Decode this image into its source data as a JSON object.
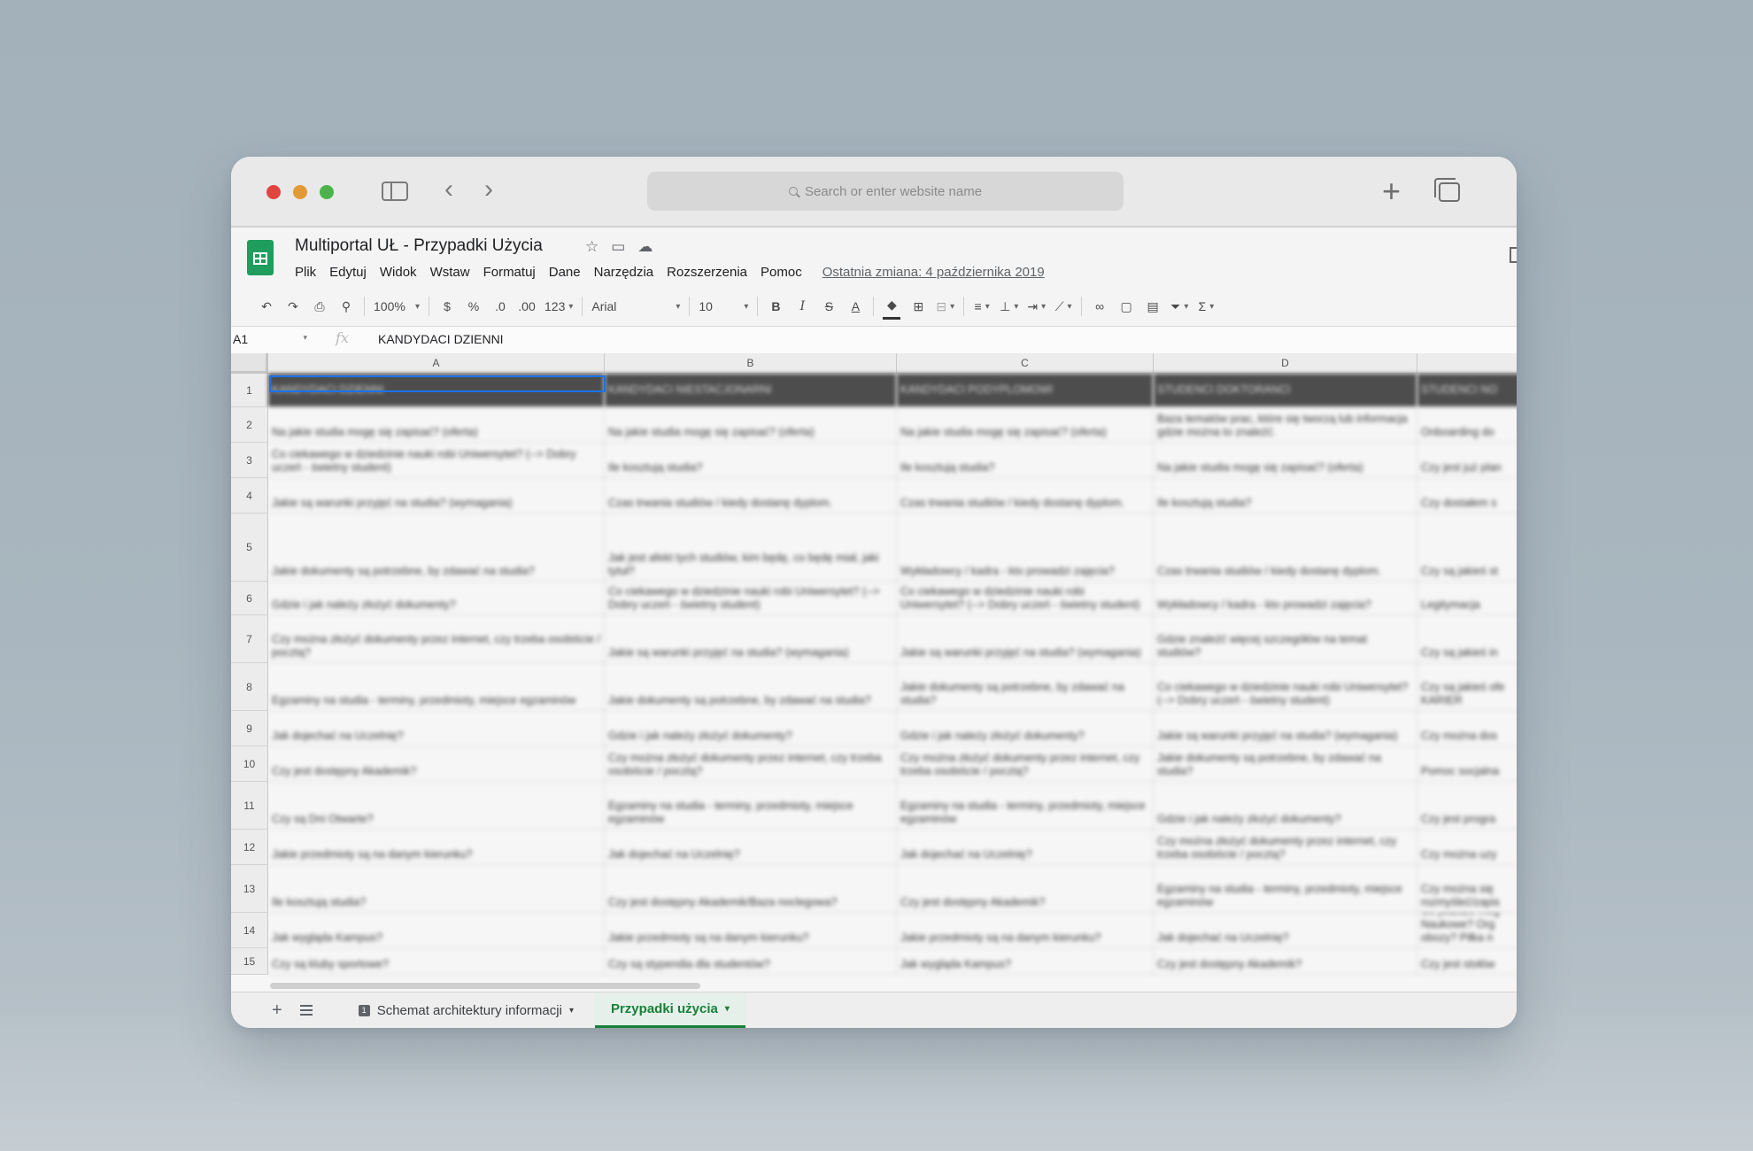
{
  "browser": {
    "search_placeholder": "Search or enter website name",
    "back_glyph": "‹",
    "forward_glyph": "›",
    "new_tab_glyph": "+"
  },
  "doc": {
    "title": "Multiportal UŁ - Przypadki Użycia",
    "last_edit": "Ostatnia zmiana: 4 października 2019"
  },
  "menu": [
    "Plik",
    "Edytuj",
    "Widok",
    "Wstaw",
    "Formatuj",
    "Dane",
    "Narzędzia",
    "Rozszerzenia",
    "Pomoc"
  ],
  "toolbar": {
    "zoom": "100%",
    "currency": "$",
    "percent": "%",
    "dec_decrease": ".0",
    "dec_increase": ".00",
    "more_formats": "123",
    "font": "Arial",
    "font_size": "10",
    "bold": "B",
    "italic": "I",
    "strike": "S",
    "text_color": "A",
    "sum": "Σ"
  },
  "formula": {
    "cell_ref": "A1",
    "fx": "fx",
    "value": "KANDYDACI DZIENNI"
  },
  "columns": [
    "A",
    "B",
    "C",
    "D",
    ""
  ],
  "rows": [
    {
      "n": "1",
      "cells": [
        "KANDYDACI DZIENNI",
        "KANDYDACI NIESTACJONARNI",
        "KANDYDACI PODYPLOMOWI",
        "STUDENCI DOKTORANCI",
        "STUDENCI NO"
      ]
    },
    {
      "n": "2",
      "cells": [
        "Na jakie studia mogę się zapisać? (oferta)",
        "Na jakie studia mogę się zapisać? (oferta)",
        "Na jakie studia mogę się zapisać? (oferta)",
        "Baza tematów prac, które się tworzą lub informacja gdzie można to znaleźć.",
        "Onboarding do"
      ]
    },
    {
      "n": "3",
      "cells": [
        "Co ciekawego w dziedzinie nauki robi Uniwersytet? (--> Dobry uczeń - świetny student)",
        "Ile kosztują studia?",
        "Ile kosztują studia?",
        "Na jakie studia mogę się zapisać? (oferta)",
        "Czy jest już plan"
      ]
    },
    {
      "n": "4",
      "cells": [
        "Jakie są warunki przyjęć na studia? (wymagania)",
        "Czas trwania studiów / kiedy dostanę dyplom.",
        "Czas trwania studiów / kiedy dostanę dyplom.",
        "Ile kosztują studia?",
        "Czy dostałem s"
      ]
    },
    {
      "n": "5",
      "cells": [
        "Jakie dokumenty są potrzebne, by zdawać na studia?",
        "Jak jest afekt tych studiów, kim będę, co będę miał, jaki tytuł?",
        "Wykładowcy / kadra - kto prowadzi zajęcia?",
        "Czas trwania studiów / kiedy dostanę dyplom.",
        "Czy są jakieś st"
      ]
    },
    {
      "n": "6",
      "cells": [
        "Gdzie i jak należy złożyć dokumenty?",
        "Co ciekawego w dziedzinie nauki robi Uniwersytet? (--> Dobry uczeń - świetny student)",
        "Co ciekawego w dziedzinie nauki robi Uniwersytet? (--> Dobry uczeń - świetny student)",
        "Wykładowcy / kadra - kto prowadzi zajęcia?",
        "Legitymacja"
      ]
    },
    {
      "n": "7",
      "cells": [
        "Czy można złożyć dokumenty przez internet, czy trzeba osobiście / pocztą?",
        "Jakie są warunki przyjęć na studia? (wymagania)",
        "Jakie są warunki przyjęć na studia? (wymagania)",
        "Gdzie znaleźć więcej szczegółów na temat studiów?",
        "Czy są jakieś in"
      ]
    },
    {
      "n": "8",
      "cells": [
        "Egzaminy na studia - terminy, przedmioty, miejsce egzaminów",
        "Jakie dokumenty są potrzebne, by zdawać na studia?",
        "Jakie dokumenty są potrzebne, by zdawać na studia?",
        "Co ciekawego w dziedzinie nauki robi Uniwersytet? (--> Dobry uczeń - świetny student)",
        "Czy są jakieś ofe KARIER"
      ]
    },
    {
      "n": "9",
      "cells": [
        "Jak dojechać na Uczelnię?",
        "Gdzie i jak należy złożyć dokumenty?",
        "Gdzie i jak należy złożyć dokumenty?",
        "Jakie są warunki przyjęć na studia? (wymagania)",
        "Czy można dos"
      ]
    },
    {
      "n": "10",
      "cells": [
        "Czy jest dostępny Akademik?",
        "Czy można złożyć dokumenty przez internet, czy trzeba osobiście / pocztą?",
        "Czy można złożyć dokumenty przez internet, czy trzeba osobiście / pocztą?",
        "Jakie dokumenty są potrzebne, by zdawać na studia?",
        "Pomoc socjalna"
      ]
    },
    {
      "n": "11",
      "cells": [
        "Czy są Dni Otwarte?",
        "Egzaminy na studia - terminy, przedmioty, miejsce egzaminów",
        "Egzaminy na studia - terminy, przedmioty, miejsce egzaminów",
        "Gdzie i jak należy złożyć dokumenty?",
        "Czy jest progra"
      ]
    },
    {
      "n": "12",
      "cells": [
        "Jakie przedmioty są na danym kierunku?",
        "Jak dojechać na Uczelnię?",
        "Jak dojechać na Uczelnię?",
        "Czy można złożyć dokumenty przez internet, czy trzeba osobiście / pocztą?",
        "Czy można uzy"
      ]
    },
    {
      "n": "13",
      "cells": [
        "Ile kosztują studia?",
        "Czy jest dostępny Akademik/Baza noclegowa?",
        "Czy jest dostępny Akademik?",
        "Egzaminy na studia - terminy, przedmioty, miejsce egzaminów",
        "Czy można się rozmyśleć/zapis"
      ]
    },
    {
      "n": "14",
      "cells": [
        "Jak wygląda Kampus?",
        "Jakie przedmioty są na danym kierunku?",
        "Jakie przedmioty są na danym kierunku?",
        "Jak dojechać na Uczelnię?",
        "Co jeszcze mog Naukowe? Org obozy? Piłka n"
      ]
    },
    {
      "n": "15",
      "cells": [
        "Czy są kluby sportowe?",
        "Czy są stypendia dla studentów?",
        "Jak wygląda Kampus?",
        "Czy jest dostępny Akademik?",
        "Czy jest stołów"
      ]
    }
  ],
  "sheets": {
    "tab1_number": "1",
    "tab1": "Schemat architektury informacji",
    "tab2": "Przypadki użycia",
    "add_glyph": "+"
  }
}
